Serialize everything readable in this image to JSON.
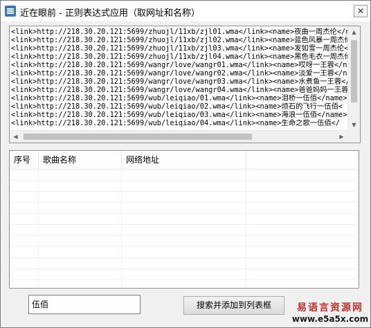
{
  "window": {
    "title": "近在眼前 - 正则表达式应用（取网址和名称）",
    "close_glyph": "✕"
  },
  "source_text": {
    "lines": [
      "<link>http://218.30.20.121:5699/zhuojl/11xb/zjl01.wma</link><name>夜曲一周杰伦</n",
      "<link>http://218.30.20.121:5699/zhuojl/11xb/zjl02.wma</link><name>蓝色风暴一周杰伦",
      "<link>http://218.30.20.121:5699/zhuojl/11xb/zjl03.wma</link><name>发如雪一周杰伦</",
      "<link>http://218.30.20.121:5699/zhuojl/11xb/zjl04.wma</link><name>黑色毛衣一周杰伦",
      "<link>http://218.30.20.121:5699/wangr/love/wangr01.wma</link><name>哎呀一王蓉</na",
      "<link>http://218.30.20.121:5699/wangr/love/wangr02.wma</link><name>淡爱一王蓉</na",
      "<link>http://218.30.20.121:5699/wangr/love/wangr03.wma</link><name>水煮鱼一王蓉</",
      "<link>http://218.30.20.121:5699/wangr/love/wangr04.wma</link><name>爸爸妈妈一王蓉",
      "<link>http://218.30.20.121:5699/wub/leiqiao/01.wma</link><name>泪桥一伍佰</name>",
      "<link>http://218.30.20.121:5699/wub/leiqiao/02.wma</link><name>烦石的飞行一伍佰<",
      "<link>http://218.30.20.121:5699/wub/leiqiao/03.wma</link><name>海浪一伍佰</name>",
      "<link>http://218.30.20.121:5699/wub/leiqiao/04.wma</link><name>生命之歌一伍佰</"
    ],
    "scroll_glyphs": {
      "up": "▲",
      "down": "▼",
      "left": "◀",
      "right": "▶"
    }
  },
  "list": {
    "columns": [
      "序号",
      "歌曲名称",
      "网络地址"
    ],
    "rows": []
  },
  "search": {
    "value": "伍佰",
    "button_label": "搜索并添加到列表框"
  },
  "watermark": {
    "text": "易语言资源网",
    "url": "www.e5a5x.com"
  },
  "colors": {
    "window_bg": "#f0f0f0",
    "watermark_red": "#c03030"
  }
}
